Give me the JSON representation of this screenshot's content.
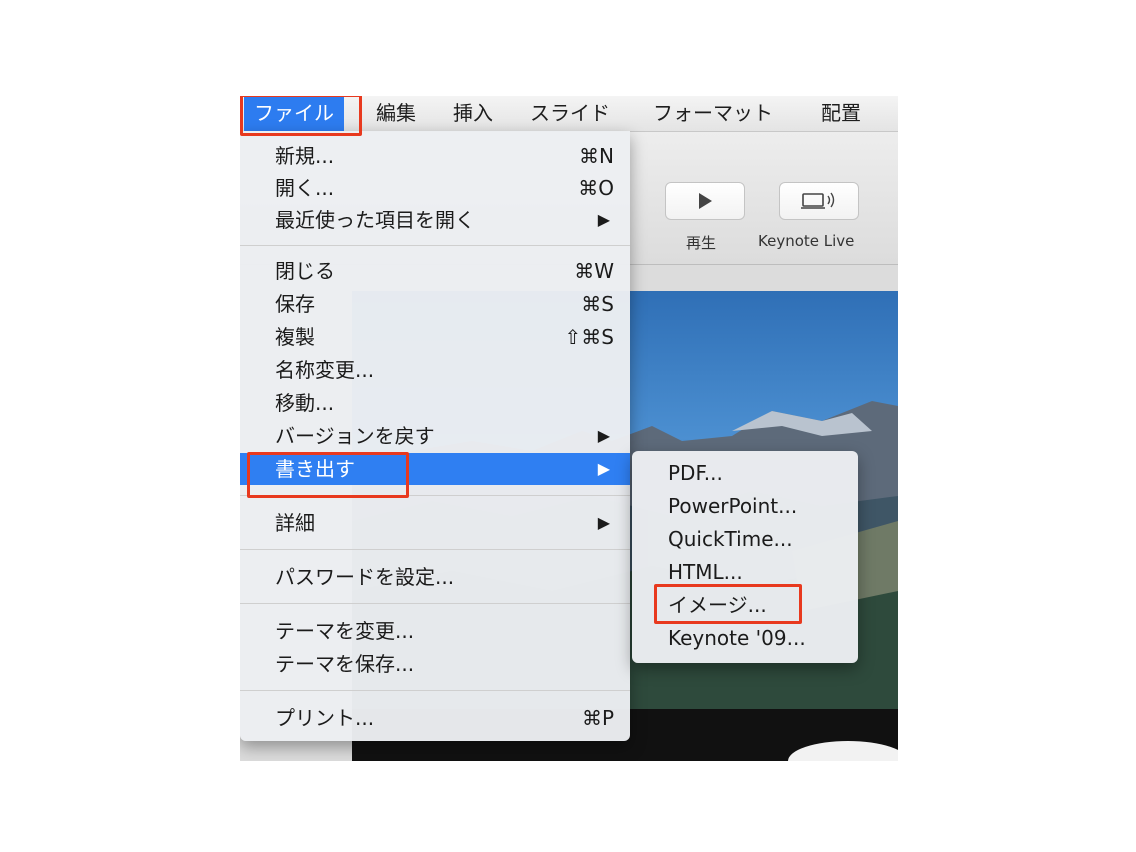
{
  "menubar": {
    "items": [
      {
        "label": "ファイル"
      },
      {
        "label": "編集"
      },
      {
        "label": "挿入"
      },
      {
        "label": "スライド"
      },
      {
        "label": "フォーマット"
      },
      {
        "label": "配置"
      }
    ]
  },
  "toolbar": {
    "play_label": "再生",
    "keynote_live_label": "Keynote Live"
  },
  "file_menu": {
    "items": [
      {
        "label": "新規...",
        "shortcut": "⌘N"
      },
      {
        "label": "開く...",
        "shortcut": "⌘O"
      },
      {
        "label": "最近使った項目を開く",
        "submenu": "▶"
      },
      {
        "label": "閉じる",
        "shortcut": "⌘W"
      },
      {
        "label": "保存",
        "shortcut": "⌘S"
      },
      {
        "label": "複製",
        "shortcut": "⇧⌘S"
      },
      {
        "label": "名称変更..."
      },
      {
        "label": "移動..."
      },
      {
        "label": "バージョンを戻す",
        "submenu": "▶"
      },
      {
        "label": "書き出す",
        "submenu": "▶"
      },
      {
        "label": "詳細",
        "submenu": "▶"
      },
      {
        "label": "パスワードを設定..."
      },
      {
        "label": "テーマを変更..."
      },
      {
        "label": "テーマを保存..."
      },
      {
        "label": "プリント...",
        "shortcut": "⌘P"
      }
    ]
  },
  "export_submenu": {
    "items": [
      {
        "label": "PDF..."
      },
      {
        "label": "PowerPoint..."
      },
      {
        "label": "QuickTime..."
      },
      {
        "label": "HTML..."
      },
      {
        "label": "イメージ..."
      },
      {
        "label": "Keynote '09..."
      }
    ]
  },
  "colors": {
    "highlight": "#2f7ff2",
    "annotation_red": "#e8391e"
  }
}
